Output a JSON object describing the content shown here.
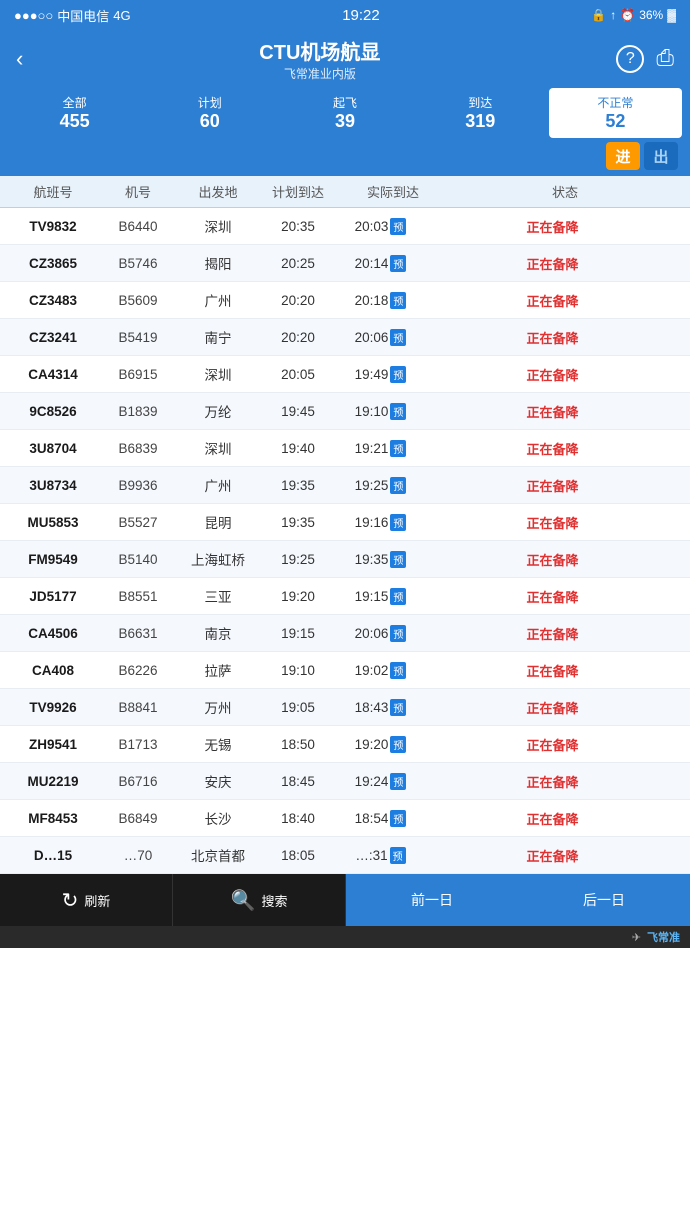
{
  "statusBar": {
    "carrier": "中国电信",
    "network": "4G",
    "time": "19:22",
    "battery": "36%"
  },
  "header": {
    "title": "CTU机场航显",
    "subtitle": "飞常准业内版",
    "backLabel": "‹",
    "helpIcon": "?",
    "shareIcon": "⎙"
  },
  "tabs": [
    {
      "id": "all",
      "label": "全部",
      "count": "455",
      "active": false
    },
    {
      "id": "plan",
      "label": "计划",
      "count": "60",
      "active": false
    },
    {
      "id": "depart",
      "label": "起飞",
      "count": "39",
      "active": false
    },
    {
      "id": "arrive",
      "label": "到达",
      "count": "319",
      "active": false
    },
    {
      "id": "abnormal",
      "label": "不正常",
      "count": "52",
      "active": true
    }
  ],
  "directionButtons": [
    {
      "id": "in",
      "label": "进",
      "active": true
    },
    {
      "id": "out",
      "label": "出",
      "active": false
    }
  ],
  "columnHeaders": {
    "flight": "航班号",
    "aircraft": "机号",
    "origin": "出发地",
    "planned": "计划到达",
    "actual": "实际到达",
    "status": "状态"
  },
  "flights": [
    {
      "flight": "TV9832",
      "aircraft": "B6440",
      "origin": "深圳",
      "planned": "20:35",
      "actual": "20:03",
      "hasPred": true,
      "status": "正在备降"
    },
    {
      "flight": "CZ3865",
      "aircraft": "B5746",
      "origin": "揭阳",
      "planned": "20:25",
      "actual": "20:14",
      "hasPred": true,
      "status": "正在备降"
    },
    {
      "flight": "CZ3483",
      "aircraft": "B5609",
      "origin": "广州",
      "planned": "20:20",
      "actual": "20:18",
      "hasPred": true,
      "status": "正在备降"
    },
    {
      "flight": "CZ3241",
      "aircraft": "B5419",
      "origin": "南宁",
      "planned": "20:20",
      "actual": "20:06",
      "hasPred": true,
      "status": "正在备降"
    },
    {
      "flight": "CA4314",
      "aircraft": "B6915",
      "origin": "深圳",
      "planned": "20:05",
      "actual": "19:49",
      "hasPred": true,
      "status": "正在备降"
    },
    {
      "flight": "9C8526",
      "aircraft": "B1839",
      "origin": "万纶",
      "planned": "19:45",
      "actual": "19:10",
      "hasPred": true,
      "status": "正在备降"
    },
    {
      "flight": "3U8704",
      "aircraft": "B6839",
      "origin": "深圳",
      "planned": "19:40",
      "actual": "19:21",
      "hasPred": true,
      "status": "正在备降"
    },
    {
      "flight": "3U8734",
      "aircraft": "B9936",
      "origin": "广州",
      "planned": "19:35",
      "actual": "19:25",
      "hasPred": true,
      "status": "正在备降"
    },
    {
      "flight": "MU5853",
      "aircraft": "B5527",
      "origin": "昆明",
      "planned": "19:35",
      "actual": "19:16",
      "hasPred": true,
      "status": "正在备降"
    },
    {
      "flight": "FM9549",
      "aircraft": "B5140",
      "origin": "上海虹桥",
      "planned": "19:25",
      "actual": "19:35",
      "hasPred": true,
      "status": "正在备降"
    },
    {
      "flight": "JD5177",
      "aircraft": "B8551",
      "origin": "三亚",
      "planned": "19:20",
      "actual": "19:15",
      "hasPred": true,
      "status": "正在备降"
    },
    {
      "flight": "CA4506",
      "aircraft": "B6631",
      "origin": "南京",
      "planned": "19:15",
      "actual": "20:06",
      "hasPred": true,
      "status": "正在备降"
    },
    {
      "flight": "CA408",
      "aircraft": "B6226",
      "origin": "拉萨",
      "planned": "19:10",
      "actual": "19:02",
      "hasPred": true,
      "status": "正在备降"
    },
    {
      "flight": "TV9926",
      "aircraft": "B8841",
      "origin": "万州",
      "planned": "19:05",
      "actual": "18:43",
      "hasPred": true,
      "status": "正在备降"
    },
    {
      "flight": "ZH9541",
      "aircraft": "B1713",
      "origin": "无锡",
      "planned": "18:50",
      "actual": "19:20",
      "hasPred": true,
      "status": "正在备降"
    },
    {
      "flight": "MU2219",
      "aircraft": "B6716",
      "origin": "安庆",
      "planned": "18:45",
      "actual": "19:24",
      "hasPred": true,
      "status": "正在备降"
    },
    {
      "flight": "MF8453",
      "aircraft": "B6849",
      "origin": "长沙",
      "planned": "18:40",
      "actual": "18:54",
      "hasPred": true,
      "status": "正在备降"
    },
    {
      "flight": "D…15",
      "aircraft": "…70",
      "origin": "北京首都",
      "planned": "18:05",
      "actual": "…:31",
      "hasPred": true,
      "status": "正在备降"
    }
  ],
  "bottomBar": {
    "refreshLabel": "刷新",
    "searchLabel": "搜索",
    "prevLabel": "前一日",
    "nextLabel": "后一日"
  },
  "watermark": {
    "brand": "飞常准",
    "icon": "✈"
  }
}
